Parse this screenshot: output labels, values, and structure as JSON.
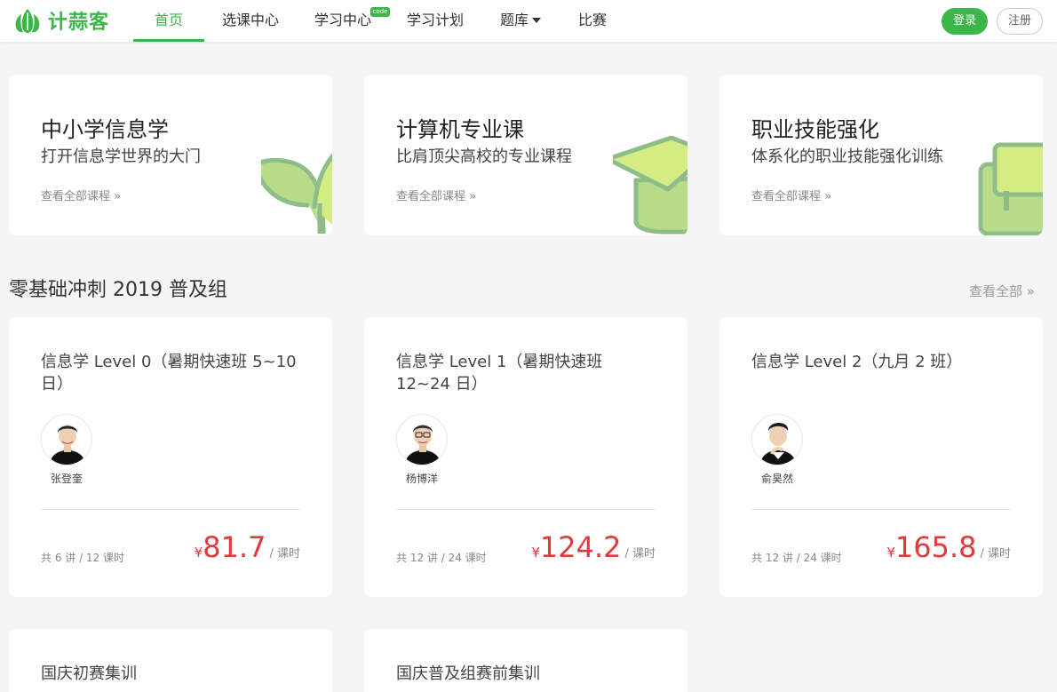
{
  "brand": {
    "name": "计蒜客",
    "accent": "#3cb64b",
    "price_color": "#e4393c"
  },
  "nav": {
    "items": [
      {
        "label": "首页",
        "active": true
      },
      {
        "label": "选课中心"
      },
      {
        "label": "学习中心"
      },
      {
        "label": "学习计划"
      },
      {
        "label": "题库"
      },
      {
        "label": "比赛"
      }
    ],
    "code_badge": "code"
  },
  "auth": {
    "login": "登录",
    "register": "注册"
  },
  "categories": [
    {
      "title": "中小学信息学",
      "subtitle": "打开信息学世界的大门",
      "link": "查看全部课程 »",
      "icon": "sprout-icon"
    },
    {
      "title": "计算机专业课",
      "subtitle": "比肩顶尖高校的专业课程",
      "link": "查看全部课程 »",
      "icon": "graduation-cap-icon"
    },
    {
      "title": "职业技能强化",
      "subtitle": "体系化的职业技能强化训练",
      "link": "查看全部课程 »",
      "icon": "briefcase-icon"
    }
  ],
  "section": {
    "title": "零基础冲刺 2019 普及组",
    "view_all": "查看全部 »"
  },
  "courses": [
    {
      "title": "信息学 Level 0（暑期快速班 5~10 日）",
      "teacher": "张登奎",
      "lessons": "共 6 讲 / 12 课时",
      "currency": "¥",
      "price": "81.7",
      "unit": "/ 课时"
    },
    {
      "title": "信息学 Level 1（暑期快速班 12~24 日）",
      "teacher": "杨博洋",
      "lessons": "共 12 讲 / 24 课时",
      "currency": "¥",
      "price": "124.2",
      "unit": "/ 课时"
    },
    {
      "title": "信息学 Level 2（九月 2 班）",
      "teacher": "俞昊然",
      "lessons": "共 12 讲 / 24 课时",
      "currency": "¥",
      "price": "165.8",
      "unit": "/ 课时"
    },
    {
      "title": "国庆初赛集训"
    },
    {
      "title": "国庆普及组赛前集训"
    }
  ]
}
